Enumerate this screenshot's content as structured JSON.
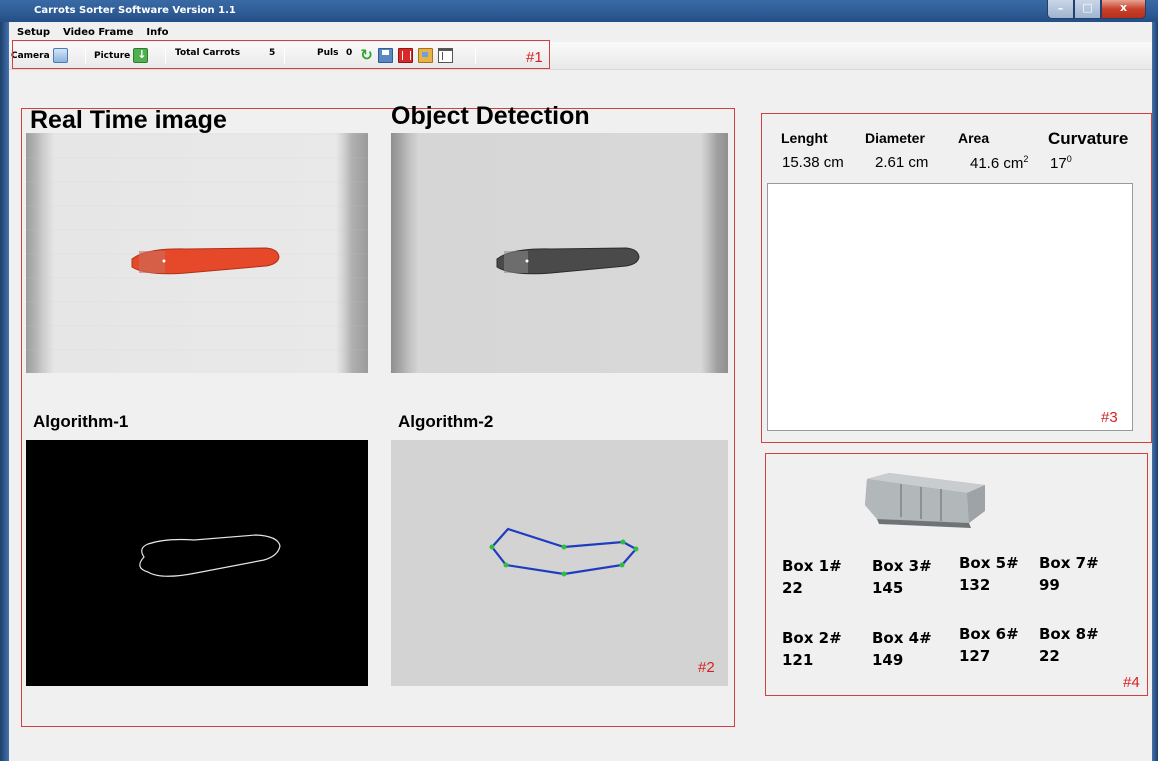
{
  "window": {
    "title": "Carrots Sorter Software Version 1.1",
    "controls": {
      "minimize": "–",
      "maximize": "□",
      "close": "x"
    }
  },
  "menu": [
    "Setup",
    "Video Frame",
    "Info"
  ],
  "toolbar": {
    "camera_label": "Camera",
    "picture_label": "Picture",
    "total_carrots_label": "Total Carrots",
    "total_carrots_value": "5",
    "puls_label": "Puls",
    "puls_value": "0",
    "section_tag": "#1",
    "icons": [
      "monitor-icon",
      "download-icon",
      "refresh-icon",
      "save-icon",
      "delete-icon",
      "folder-image-icon",
      "window-icon"
    ]
  },
  "images_panel": {
    "real_time_title": "Real Time image",
    "object_detection_title": "Object Detection",
    "algorithm1_title": "Algorithm-1",
    "algorithm2_title": "Algorithm-2",
    "section_tag": "#2",
    "colors": {
      "carrot": "#e5492a",
      "carrot_gray": "#4a4a4a",
      "contour": "#1f3cc0",
      "vertex": "#2fbf3f"
    }
  },
  "measurements": {
    "lenght_label": "Lenght",
    "lenght_value": "15.38 cm",
    "diameter_label": "Diameter",
    "diameter_value": "2.61 cm",
    "area_label": "Area",
    "area_value": "41.6 cm",
    "area_unit_sup": "2",
    "curvature_label": "Curvature",
    "curvature_value": "17",
    "curvature_unit_sup": "0",
    "section_tag": "#3"
  },
  "boxes": {
    "section_tag": "#4",
    "items": [
      {
        "label": "Box 1#",
        "value": "22"
      },
      {
        "label": "Box 2#",
        "value": "121"
      },
      {
        "label": "Box 3#",
        "value": "145"
      },
      {
        "label": "Box 4#",
        "value": "149"
      },
      {
        "label": "Box 5#",
        "value": "132"
      },
      {
        "label": "Box 6#",
        "value": "127"
      },
      {
        "label": "Box 7#",
        "value": "99"
      },
      {
        "label": "Box 8#",
        "value": "22"
      }
    ]
  }
}
